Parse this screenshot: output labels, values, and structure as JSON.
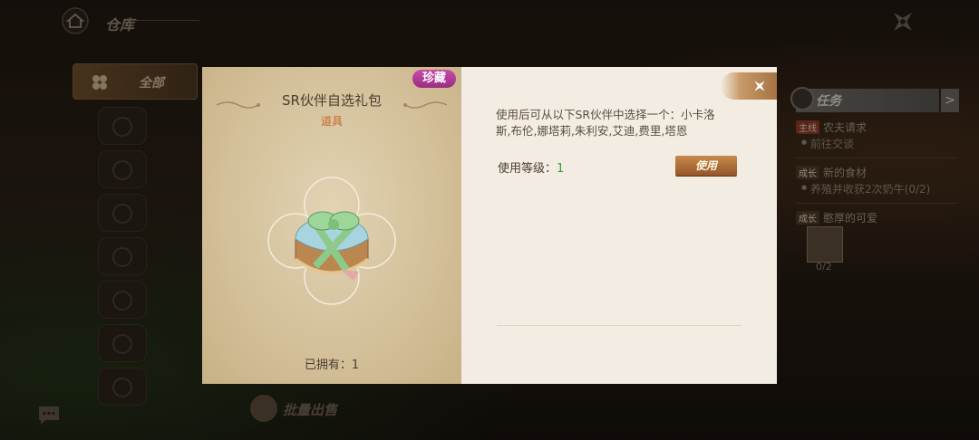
{
  "header": {
    "title": "仓库"
  },
  "sidebar": {
    "all_label": "全部"
  },
  "footer": {
    "batch_sell_label": "批量出售"
  },
  "tasks": {
    "header": "任务",
    "arrow": ">",
    "items": [
      {
        "tag": "主线",
        "title": "农夫请求",
        "sub": "前往交谈"
      },
      {
        "tag": "成长",
        "title": "新的食材",
        "sub": "养殖并收获2次奶牛(0/2)"
      },
      {
        "tag": "成长",
        "title": "憨厚的可爱",
        "sub": ""
      }
    ],
    "item_count": "0/2"
  },
  "item_modal": {
    "rarity": "珍藏",
    "name": "SR伙伴自选礼包",
    "type": "道具",
    "owned_text": "已拥有：1",
    "description": "使用后可从以下SR伙伴中选择一个：小卡洛斯,布伦,娜塔莉,朱利安,艾迪,费里,塔恩",
    "level_label": "使用等级：",
    "level_value": "1",
    "use_label": "使用"
  }
}
